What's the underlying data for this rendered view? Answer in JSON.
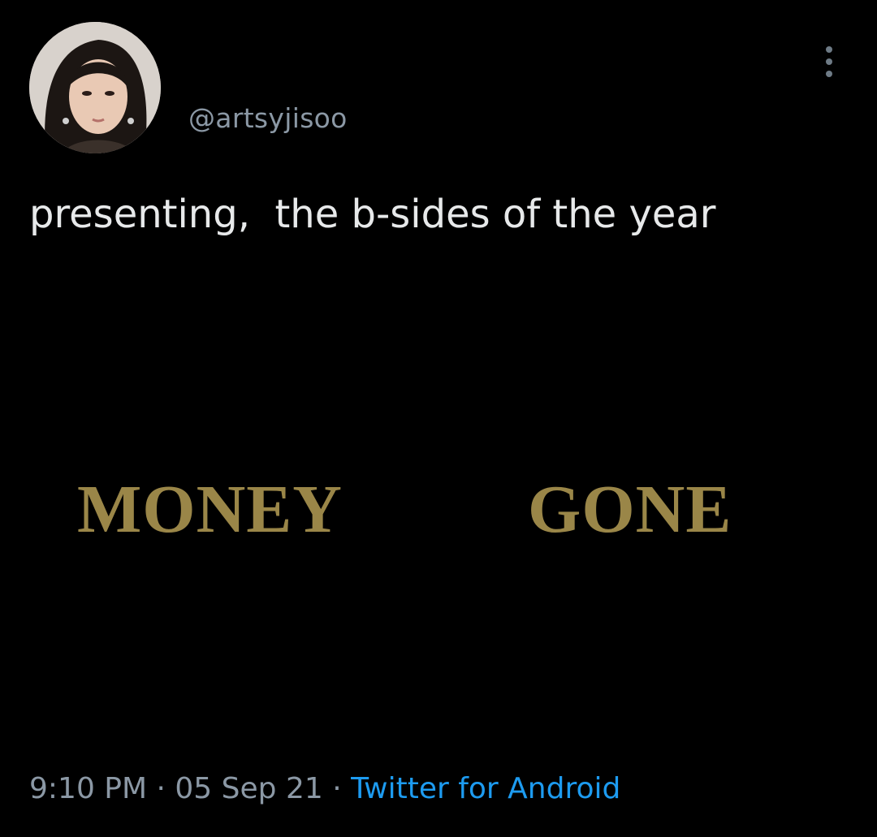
{
  "tweet": {
    "handle": "@artsyjisoo",
    "text": "presenting,  the b-sides of the year",
    "graphic_words": [
      "MONEY",
      "GONE"
    ],
    "time": "9:10 PM",
    "separator": " · ",
    "date": "05 Sep 21",
    "source": "Twitter for Android"
  },
  "icons": {
    "more": "more-vertical-icon"
  },
  "colors": {
    "background": "#000000",
    "text": "#e7e9ea",
    "muted": "#8b98a5",
    "link": "#1d9bf0",
    "gold": "#9a8648"
  }
}
